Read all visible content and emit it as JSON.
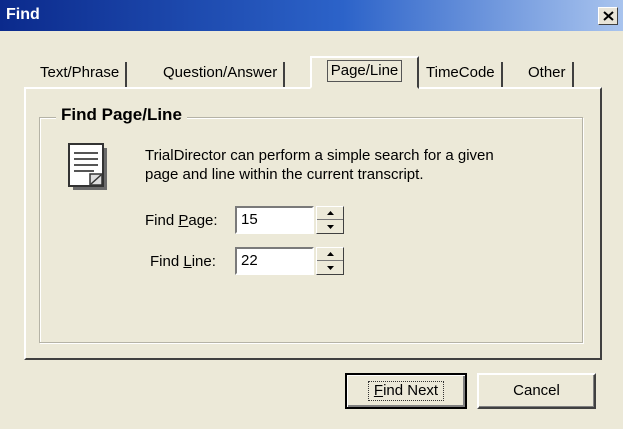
{
  "window": {
    "title": "Find",
    "close_icon": "close-icon"
  },
  "tabs": [
    {
      "label": "Text/Phrase",
      "active": false
    },
    {
      "label": "Question/Answer",
      "active": false
    },
    {
      "label": "Page/Line",
      "active": true
    },
    {
      "label": "TimeCode",
      "active": false
    },
    {
      "label": "Other",
      "active": false
    }
  ],
  "group": {
    "title": "Find Page/Line",
    "icon": "document-icon",
    "description_line1": "TrialDirector can perform a simple search for a given",
    "description_line2": "page and line within the current transcript."
  },
  "fields": {
    "page": {
      "label_pre": "Find ",
      "label_accel": "P",
      "label_post": "age:",
      "value": "15"
    },
    "line": {
      "label_pre": "Find ",
      "label_accel": "L",
      "label_post": "ine:",
      "value": "22"
    }
  },
  "buttons": {
    "find_next": {
      "accel": "F",
      "rest": "ind Next"
    },
    "cancel": {
      "label": "Cancel"
    }
  }
}
